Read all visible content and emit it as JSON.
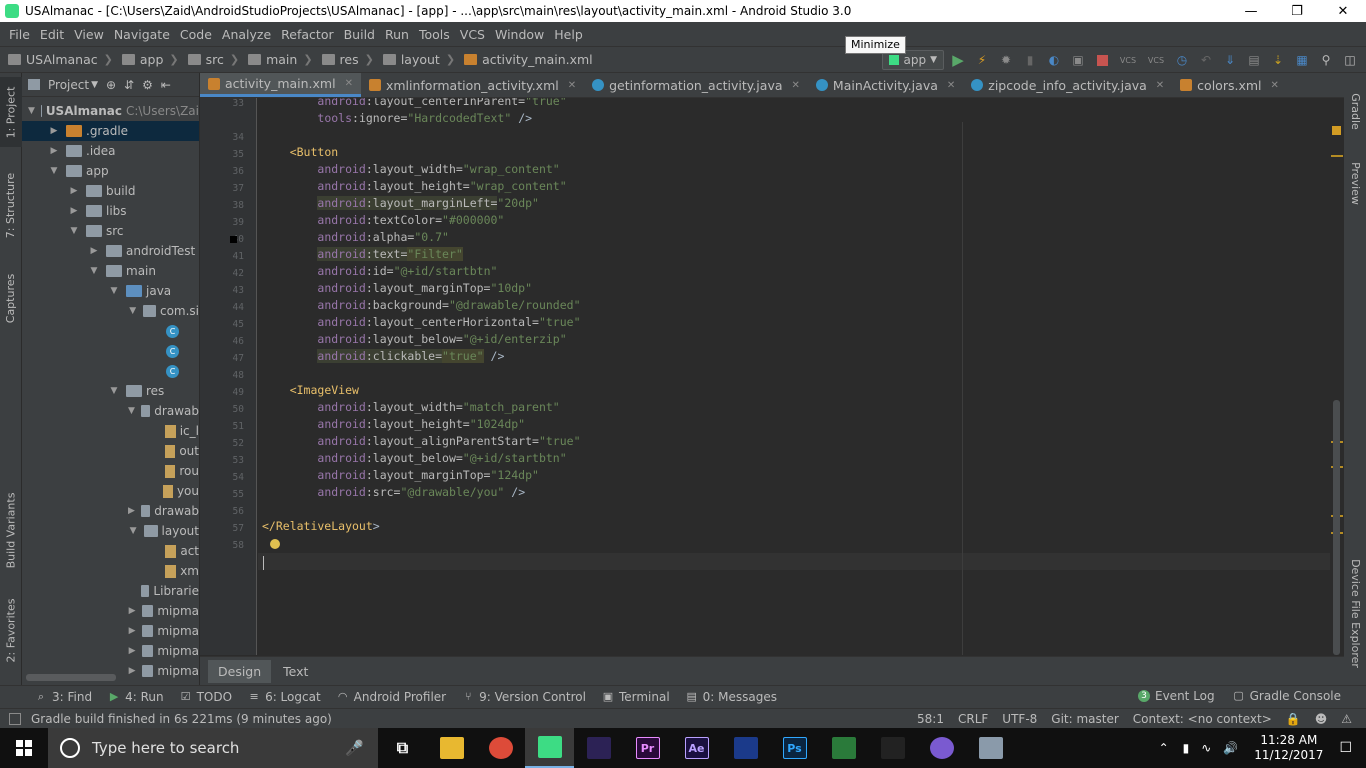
{
  "window": {
    "title": "USAlmanac - [C:\\Users\\Zaid\\AndroidStudioProjects\\USAlmanac] - [app] - ...\\app\\src\\main\\res\\layout\\activity_main.xml - Android Studio 3.0"
  },
  "menu": [
    "File",
    "Edit",
    "View",
    "Navigate",
    "Code",
    "Analyze",
    "Refactor",
    "Build",
    "Run",
    "Tools",
    "VCS",
    "Window",
    "Help"
  ],
  "nav": {
    "crumbs": [
      "USAlmanac",
      "app",
      "src",
      "main",
      "res",
      "layout",
      "activity_main.xml"
    ],
    "run_config": "app"
  },
  "tooltip": "Minimize",
  "left_strip": [
    "1: Project",
    "7: Structure",
    "Captures",
    "Build Variants",
    "2: Favorites"
  ],
  "right_strip": [
    "Gradle",
    "Preview",
    "Device File Explorer"
  ],
  "project": {
    "view_label": "Project",
    "tree": [
      {
        "label": "USAlmanac",
        "extra": "C:\\Users\\Zai",
        "indent": 0,
        "arrow": "▼",
        "icon": "fold"
      },
      {
        "label": ".gradle",
        "indent": 1,
        "arrow": "▶",
        "icon": "fold-orange",
        "selected": true
      },
      {
        "label": ".idea",
        "indent": 1,
        "arrow": "▶",
        "icon": "fold"
      },
      {
        "label": "app",
        "indent": 1,
        "arrow": "▼",
        "icon": "fold"
      },
      {
        "label": "build",
        "indent": 2,
        "arrow": "▶",
        "icon": "fold"
      },
      {
        "label": "libs",
        "indent": 2,
        "arrow": "▶",
        "icon": "fold"
      },
      {
        "label": "src",
        "indent": 2,
        "arrow": "▼",
        "icon": "fold"
      },
      {
        "label": "androidTest",
        "indent": 3,
        "arrow": "▶",
        "icon": "fold"
      },
      {
        "label": "main",
        "indent": 3,
        "arrow": "▼",
        "icon": "fold"
      },
      {
        "label": "java",
        "indent": 4,
        "arrow": "▼",
        "icon": "fold-blue"
      },
      {
        "label": "com.si",
        "indent": 5,
        "arrow": "▼",
        "icon": "fold"
      },
      {
        "label": "",
        "indent": 6,
        "arrow": "",
        "icon": "cls"
      },
      {
        "label": "",
        "indent": 6,
        "arrow": "",
        "icon": "cls"
      },
      {
        "label": "",
        "indent": 6,
        "arrow": "",
        "icon": "cls"
      },
      {
        "label": "res",
        "indent": 4,
        "arrow": "▼",
        "icon": "fold"
      },
      {
        "label": "drawab",
        "indent": 5,
        "arrow": "▼",
        "icon": "fold"
      },
      {
        "label": "ic_l",
        "indent": 6,
        "arrow": "",
        "icon": "fi"
      },
      {
        "label": "out",
        "indent": 6,
        "arrow": "",
        "icon": "fi"
      },
      {
        "label": "rou",
        "indent": 6,
        "arrow": "",
        "icon": "fi"
      },
      {
        "label": "you",
        "indent": 6,
        "arrow": "",
        "icon": "fi"
      },
      {
        "label": "drawab",
        "indent": 5,
        "arrow": "▶",
        "icon": "fold"
      },
      {
        "label": "layout",
        "indent": 5,
        "arrow": "▼",
        "icon": "fold"
      },
      {
        "label": "act",
        "indent": 6,
        "arrow": "",
        "icon": "fi"
      },
      {
        "label": "xm",
        "indent": 6,
        "arrow": "",
        "icon": "fi"
      },
      {
        "label": "Librarie",
        "indent": 5,
        "arrow": "",
        "icon": "fold"
      },
      {
        "label": "mipma",
        "indent": 5,
        "arrow": "▶",
        "icon": "fold"
      },
      {
        "label": "mipma",
        "indent": 5,
        "arrow": "▶",
        "icon": "fold"
      },
      {
        "label": "mipma",
        "indent": 5,
        "arrow": "▶",
        "icon": "fold"
      },
      {
        "label": "mipma",
        "indent": 5,
        "arrow": "▶",
        "icon": "fold"
      }
    ]
  },
  "tabs": [
    {
      "label": "activity_main.xml",
      "type": "xml",
      "active": true
    },
    {
      "label": "xmlinformation_activity.xml",
      "type": "xml"
    },
    {
      "label": "getinformation_activity.java",
      "type": "java"
    },
    {
      "label": "MainActivity.java",
      "type": "java"
    },
    {
      "label": "zipcode_info_activity.java",
      "type": "java"
    },
    {
      "label": "colors.xml",
      "type": "xml"
    }
  ],
  "code": [
    {
      "n": "33",
      "t": "        android:layout_centerInParent=\"true\""
    },
    {
      "n": "",
      "t": "        tools:ignore=\"HardcodedText\" />"
    },
    {
      "n": "34",
      "t": ""
    },
    {
      "n": "35",
      "t": "    <Button"
    },
    {
      "n": "36",
      "t": "        android:layout_width=\"wrap_content\""
    },
    {
      "n": "37",
      "t": "        android:layout_height=\"wrap_content\""
    },
    {
      "n": "38",
      "t": "        android:layout_marginLeft=\"20dp\""
    },
    {
      "n": "39",
      "t": "        android:textColor=\"#000000\""
    },
    {
      "n": "40",
      "t": "        android:alpha=\"0.7\""
    },
    {
      "n": "41",
      "t": "        android:text=\"Filter\""
    },
    {
      "n": "42",
      "t": "        android:id=\"@+id/startbtn\""
    },
    {
      "n": "43",
      "t": "        android:layout_marginTop=\"10dp\""
    },
    {
      "n": "44",
      "t": "        android:background=\"@drawable/rounded\""
    },
    {
      "n": "45",
      "t": "        android:layout_centerHorizontal=\"true\""
    },
    {
      "n": "46",
      "t": "        android:layout_below=\"@+id/enterzip\""
    },
    {
      "n": "47",
      "t": "        android:clickable=\"true\" />"
    },
    {
      "n": "48",
      "t": ""
    },
    {
      "n": "49",
      "t": "    <ImageView"
    },
    {
      "n": "50",
      "t": "        android:layout_width=\"match_parent\""
    },
    {
      "n": "51",
      "t": "        android:layout_height=\"1024dp\""
    },
    {
      "n": "52",
      "t": "        android:layout_alignParentStart=\"true\""
    },
    {
      "n": "53",
      "t": "        android:layout_below=\"@+id/startbtn\""
    },
    {
      "n": "54",
      "t": "        android:layout_marginTop=\"124dp\""
    },
    {
      "n": "55",
      "t": "        android:src=\"@drawable/you\" />"
    },
    {
      "n": "56",
      "t": ""
    },
    {
      "n": "57",
      "t": "</RelativeLayout>"
    },
    {
      "n": "58",
      "t": ""
    }
  ],
  "editor_tabs": [
    "Design",
    "Text"
  ],
  "tool_windows": [
    {
      "icon": "search-icon",
      "label": "3: Find"
    },
    {
      "icon": "run-icon",
      "label": "4: Run"
    },
    {
      "icon": "todo-icon",
      "label": "TODO"
    },
    {
      "icon": "logcat-icon",
      "label": "6: Logcat"
    },
    {
      "icon": "profiler-icon",
      "label": "Android Profiler"
    },
    {
      "icon": "vcs-icon",
      "label": "9: Version Control"
    },
    {
      "icon": "terminal-icon",
      "label": "Terminal"
    },
    {
      "icon": "messages-icon",
      "label": "0: Messages"
    }
  ],
  "tool_windows_right": [
    {
      "icon": "event-log-icon",
      "label": "Event Log",
      "badge": "3"
    },
    {
      "icon": "gradle-console-icon",
      "label": "Gradle Console"
    }
  ],
  "status": {
    "message": "Gradle build finished in 6s 221ms (9 minutes ago)",
    "position": "58:1",
    "line_sep": "CRLF",
    "encoding": "UTF-8",
    "git": "Git: master",
    "context": "Context: <no context>"
  },
  "taskbar": {
    "search_placeholder": "Type here to search",
    "apps": [
      {
        "name": "task-view",
        "label": ""
      },
      {
        "name": "file-explorer",
        "label": ""
      },
      {
        "name": "chrome",
        "label": ""
      },
      {
        "name": "android-studio",
        "label": ""
      },
      {
        "name": "eclipse",
        "label": ""
      },
      {
        "name": "premiere",
        "label": "Pr"
      },
      {
        "name": "after-effects",
        "label": "Ae"
      },
      {
        "name": "app-blue",
        "label": ""
      },
      {
        "name": "photoshop",
        "label": "Ps"
      },
      {
        "name": "spreadsheet",
        "label": ""
      },
      {
        "name": "unity",
        "label": ""
      },
      {
        "name": "app-purple",
        "label": ""
      },
      {
        "name": "app-gray",
        "label": ""
      }
    ],
    "time": "11:28 AM",
    "date": "11/12/2017"
  },
  "colors": {
    "accent": "#4a88c7",
    "run_green": "#59a869",
    "stop_red": "#c75450"
  }
}
